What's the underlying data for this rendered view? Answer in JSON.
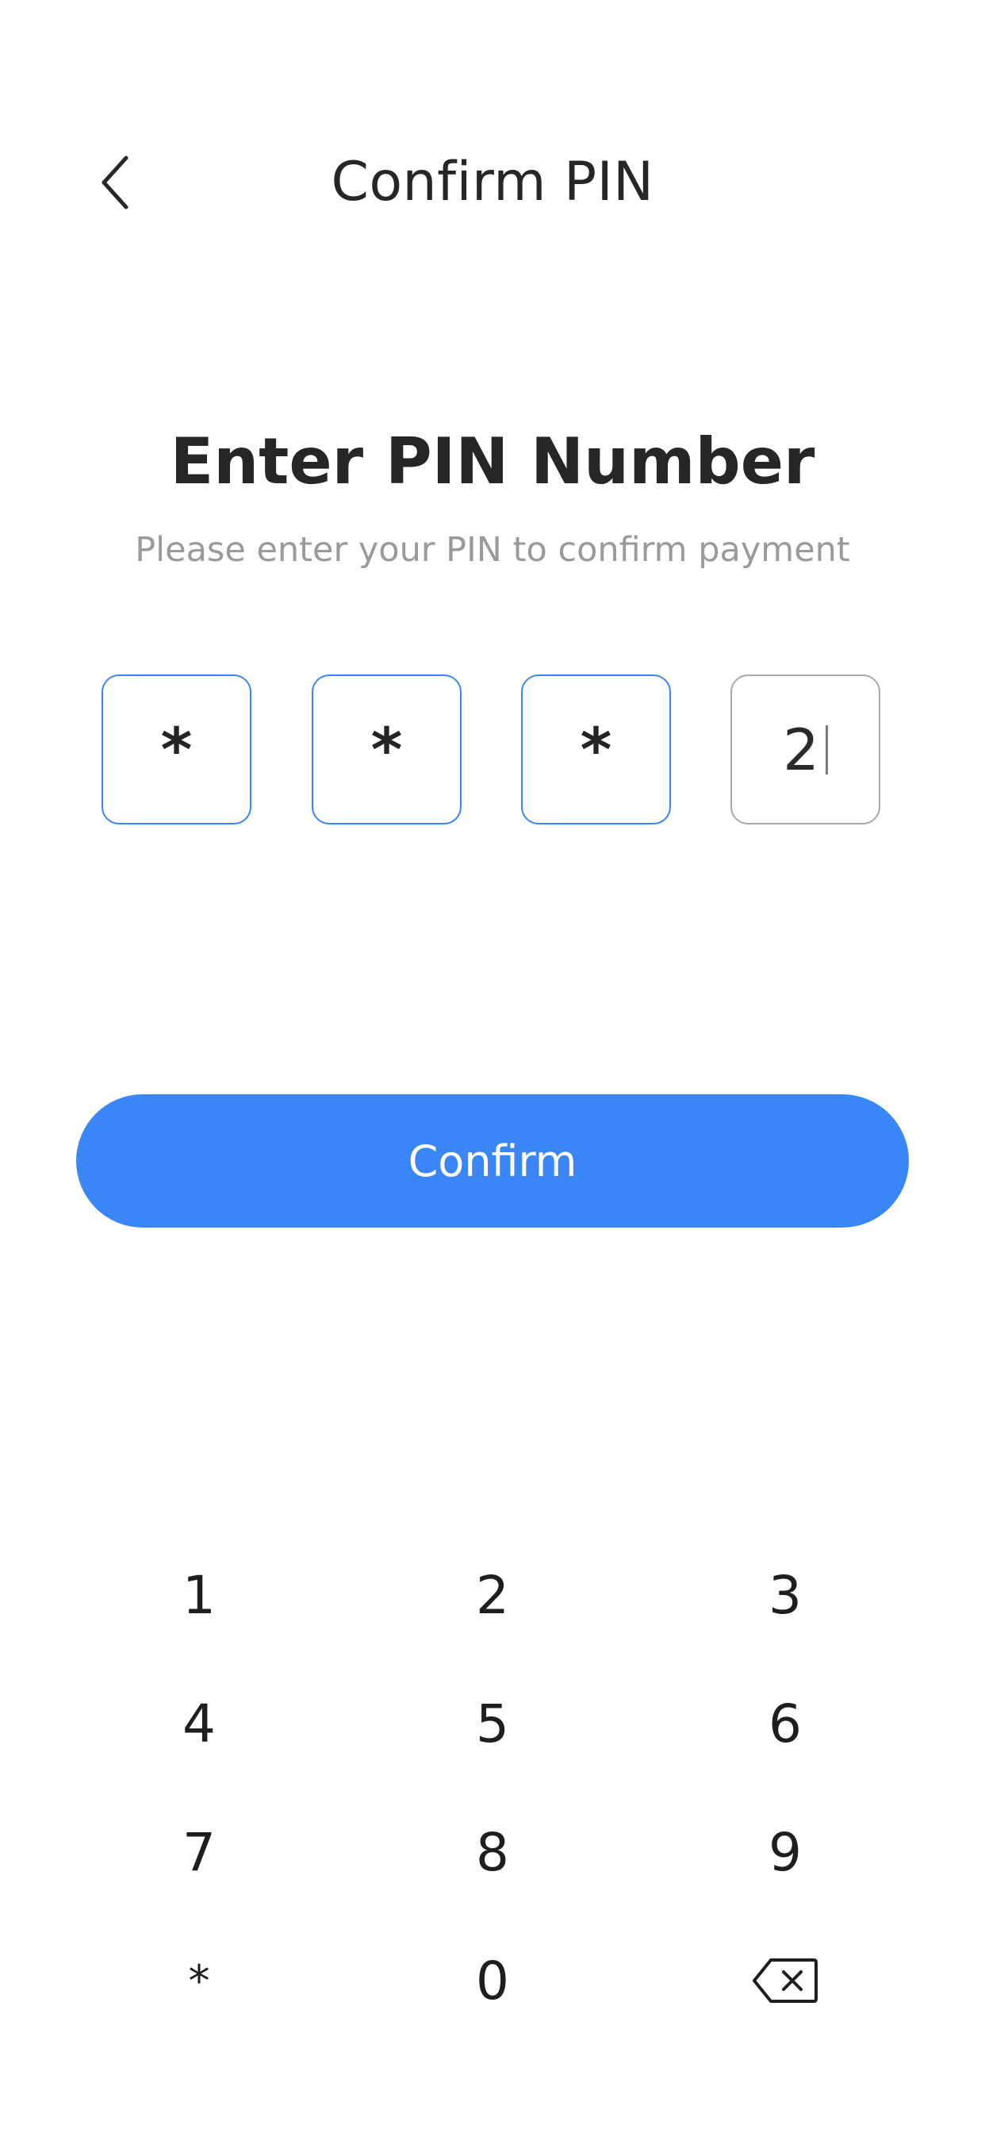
{
  "header": {
    "title": "Confirm PIN",
    "back_icon": "chevron-left-icon"
  },
  "main": {
    "heading": "Enter PIN Number",
    "subheading": "Please enter your PIN to confirm payment"
  },
  "pin": {
    "digits": [
      "*",
      "*",
      "*",
      "2"
    ],
    "active_index": 3,
    "filled_border_color": "#3a86f7",
    "active_border_color": "#a8a8a8"
  },
  "confirm_button": {
    "label": "Confirm",
    "color": "#3a86f7"
  },
  "keypad": {
    "keys": [
      "1",
      "2",
      "3",
      "4",
      "5",
      "6",
      "7",
      "8",
      "9",
      "*",
      "0"
    ],
    "backspace_icon": "backspace-icon"
  }
}
